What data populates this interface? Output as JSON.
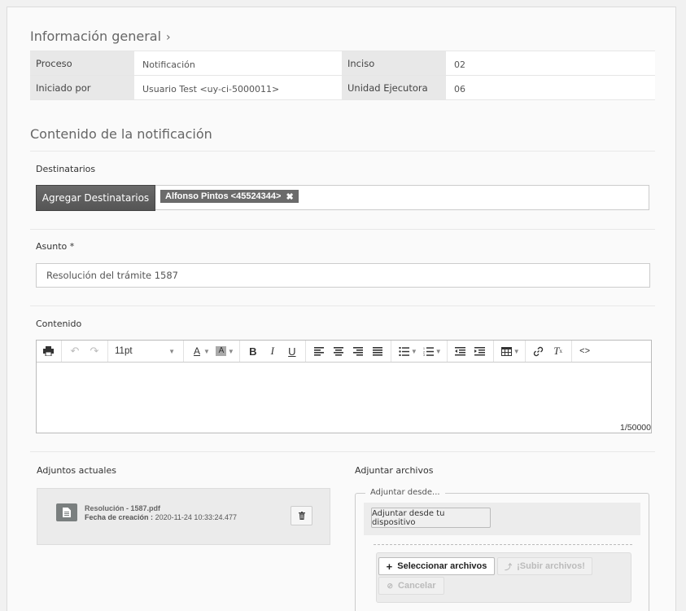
{
  "general": {
    "title": "Información general",
    "rows": [
      {
        "label1": "Proceso",
        "value1": "Notificación",
        "label2": "Inciso",
        "value2": "02"
      },
      {
        "label1": "Iniciado por",
        "value1": "Usuario Test <uy-ci-5000011>",
        "label2": "Unidad Ejecutora",
        "value2": "06"
      }
    ]
  },
  "notification": {
    "title": "Contenido de la notificación",
    "recipients": {
      "label": "Destinatarios",
      "add_button": "Agregar Destinatarios",
      "tags": [
        "Alfonso Pintos <45524344>"
      ]
    },
    "subject": {
      "label": "Asunto *",
      "value": "Resolución del trámite 1587"
    },
    "content": {
      "label": "Contenido",
      "font_size": "11pt",
      "counter": "1/50000"
    }
  },
  "attachments": {
    "current_title": "Adjuntos actuales",
    "file_name": "Resolución - 1587.pdf",
    "created_label": "Fecha de creación :",
    "created_value": "2020-11-24 10:33:24.477"
  },
  "upload": {
    "title": "Adjuntar archivos",
    "legend": "Adjuntar desde...",
    "device_button": "Adjuntar desde tu dispositivo",
    "select_button": "Seleccionar archivos",
    "upload_button": "¡Subir archivos!",
    "cancel_button": "Cancelar"
  }
}
